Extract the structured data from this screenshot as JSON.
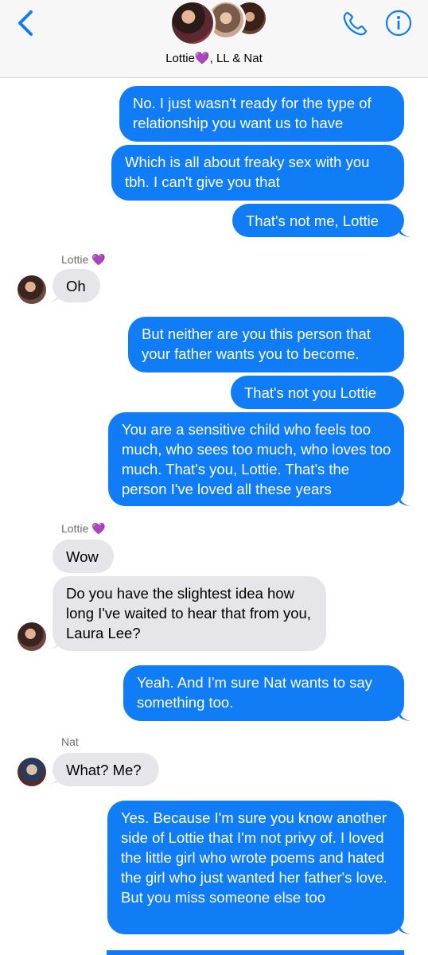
{
  "header": {
    "group_name_prefix": "Lottie",
    "heart_emoji": "💜",
    "group_name_suffix": ", LL & Nat",
    "accent_color": "#107cf6"
  },
  "messages": [
    {
      "dir": "out",
      "text": "No. I just wasn't ready for the type of relationship you want us to have"
    },
    {
      "dir": "out",
      "text": "Which is all about freaky sex with you tbh. I can't give you that"
    },
    {
      "dir": "out",
      "text": "That's not me, Lottie"
    },
    {
      "dir": "sender",
      "text": "Lottie",
      "emoji": "💜"
    },
    {
      "dir": "in",
      "text": "Oh"
    },
    {
      "dir": "out",
      "text": "But neither are you this person that your father wants you to become."
    },
    {
      "dir": "out",
      "text": "That's not you  Lottie"
    },
    {
      "dir": "out",
      "text": "You are a sensitive child who feels too much, who sees too much, who loves too much. That's you, Lottie. That's the person I've loved all these years"
    },
    {
      "dir": "sender",
      "text": "Lottie",
      "emoji": "💜"
    },
    {
      "dir": "in",
      "text": "Wow"
    },
    {
      "dir": "in",
      "text": "Do you have the slightest idea how long I've waited to hear that from you, Laura Lee?"
    },
    {
      "dir": "out",
      "text": "Yeah. And I'm sure Nat wants to say something too."
    },
    {
      "dir": "sender",
      "text": "Nat"
    },
    {
      "dir": "in",
      "text": "What? Me?"
    },
    {
      "dir": "out",
      "text": "Yes. Because I'm sure you know another side of Lottie that I'm not privy of. I loved the little girl who wrote poems and hated the girl who just wanted her father's love. But you miss someone else too"
    }
  ],
  "icons": {
    "back": "chevron-left-icon",
    "phone": "phone-icon",
    "info": "info-icon"
  }
}
